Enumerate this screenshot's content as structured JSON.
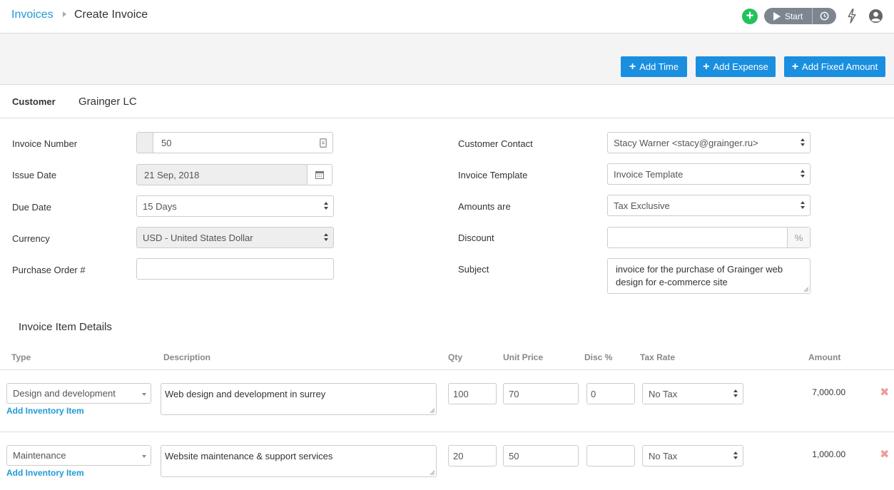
{
  "header": {
    "breadcrumb_root": "Invoices",
    "breadcrumb_current": "Create Invoice",
    "timer_start_label": "Start"
  },
  "actions": {
    "add_time": "Add Time",
    "add_expense": "Add Expense",
    "add_fixed_amount": "Add Fixed Amount"
  },
  "customer": {
    "label": "Customer",
    "name": "Grainger LC"
  },
  "left_form": {
    "invoice_number_label": "Invoice Number",
    "invoice_number_value": "50",
    "issue_date_label": "Issue Date",
    "issue_date_value": "21 Sep, 2018",
    "due_date_label": "Due Date",
    "due_date_value": "15 Days",
    "currency_label": "Currency",
    "currency_value": "USD - United States Dollar",
    "po_label": "Purchase Order #",
    "po_value": ""
  },
  "right_form": {
    "contact_label": "Customer Contact",
    "contact_value": "Stacy Warner <stacy@grainger.ru>",
    "template_label": "Invoice Template",
    "template_value": "Invoice Template",
    "amounts_label": "Amounts are",
    "amounts_value": "Tax Exclusive",
    "discount_label": "Discount",
    "discount_value": "",
    "discount_suffix": "%",
    "subject_label": "Subject",
    "subject_value": "invoice for the purchase of Grainger web design for e-commerce site"
  },
  "items": {
    "title": "Invoice Item Details",
    "columns": {
      "type": "Type",
      "description": "Description",
      "qty": "Qty",
      "unit_price": "Unit Price",
      "disc": "Disc %",
      "tax_rate": "Tax Rate",
      "amount": "Amount"
    },
    "rows": [
      {
        "type": "Design and development",
        "add_link": "Add Inventory Item",
        "description": "Web design and development in surrey",
        "qty": "100",
        "unit_price": "70",
        "disc": "0",
        "tax_rate": "No Tax",
        "amount": "7,000.00"
      },
      {
        "type": "Maintenance",
        "add_link": "Add Inventory Item",
        "description": "Website maintenance & support services",
        "qty": "20",
        "unit_price": "50",
        "disc": "",
        "tax_rate": "No Tax",
        "amount": "1,000.00"
      }
    ]
  },
  "colors": {
    "accent_blue": "#1a8fe0",
    "link_blue": "#1e9ad6",
    "green": "#21c35b",
    "delete_red": "#f29a9a"
  }
}
